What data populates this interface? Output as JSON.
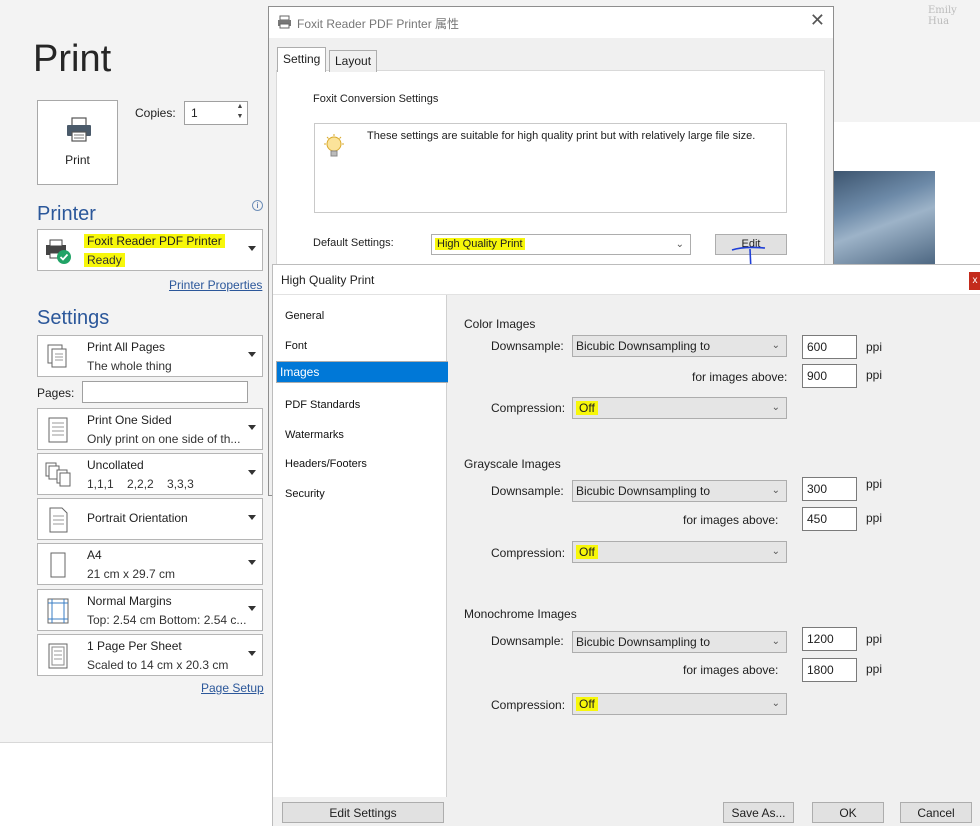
{
  "backstage": {
    "title": "Print",
    "print_button_label": "Print",
    "copies_label": "Copies:",
    "copies_value": "1",
    "printer_heading": "Printer",
    "printer": {
      "name": "Foxit Reader PDF Printer",
      "status": "Ready"
    },
    "printer_properties_link": "Printer Properties",
    "settings_heading": "Settings",
    "pages_label": "Pages:",
    "settings": [
      {
        "line1": "Print All Pages",
        "line2": "The whole thing",
        "icon": "pages-icon"
      },
      {
        "line1": "Print One Sided",
        "line2": "Only print on one side of th...",
        "icon": "one-sided-icon"
      },
      {
        "line1": "Uncollated",
        "line2": "1,1,1    2,2,2    3,3,3",
        "icon": "collate-icon"
      },
      {
        "line1": "Portrait Orientation",
        "line2": "",
        "icon": "portrait-icon"
      },
      {
        "line1": "A4",
        "line2": "21 cm x 29.7 cm",
        "icon": "paper-size-icon"
      },
      {
        "line1": "Normal Margins",
        "line2": "Top: 2.54 cm Bottom: 2.54 c...",
        "icon": "margins-icon"
      },
      {
        "line1": "1 Page Per Sheet",
        "line2": "Scaled to 14 cm x 20.3 cm",
        "icon": "pages-per-sheet-icon"
      }
    ],
    "page_setup_link": "Page Setup",
    "signature_text": "Emily Hua"
  },
  "foxit_dialog": {
    "title": "Foxit Reader PDF Printer 属性",
    "tabs": [
      "Setting",
      "Layout"
    ],
    "conversion_label": "Foxit Conversion Settings",
    "conversion_description": "These settings are suitable for high quality print but with relatively large file size.",
    "default_settings_label": "Default Settings:",
    "default_settings_value": "High Quality Print",
    "edit_button": "Edit"
  },
  "hqp_dialog": {
    "title": "High Quality Print",
    "close_label": "x",
    "nav": [
      "General",
      "Font",
      "Images",
      "PDF Standards",
      "Watermarks",
      "Headers/Footers",
      "Security"
    ],
    "selected_nav": "Images",
    "groups": [
      {
        "heading": "Color Images",
        "downsample_label": "Downsample:",
        "downsample_value": "Bicubic Downsampling to",
        "ppi": "600",
        "above_label": "for images above:",
        "above_ppi": "900",
        "compression_label": "Compression:",
        "compression_value": "Off"
      },
      {
        "heading": "Grayscale Images",
        "downsample_label": "Downsample:",
        "downsample_value": "Bicubic Downsampling to",
        "ppi": "300",
        "above_label": "for images above:",
        "above_ppi": "450",
        "compression_label": "Compression:",
        "compression_value": "Off"
      },
      {
        "heading": "Monochrome Images",
        "downsample_label": "Downsample:",
        "downsample_value": "Bicubic Downsampling to",
        "ppi": "1200",
        "above_label": "for images above:",
        "above_ppi": "1800",
        "compression_label": "Compression:",
        "compression_value": "Off"
      }
    ],
    "unit": "ppi",
    "buttons": {
      "edit_settings": "Edit Settings",
      "save_as": "Save As...",
      "ok": "OK",
      "cancel": "Cancel"
    }
  },
  "colors": {
    "accent_blue": "#2b579a",
    "nav_selected": "#0078d7",
    "highlight": "#f7f70a",
    "close_red": "#c42b1c"
  }
}
